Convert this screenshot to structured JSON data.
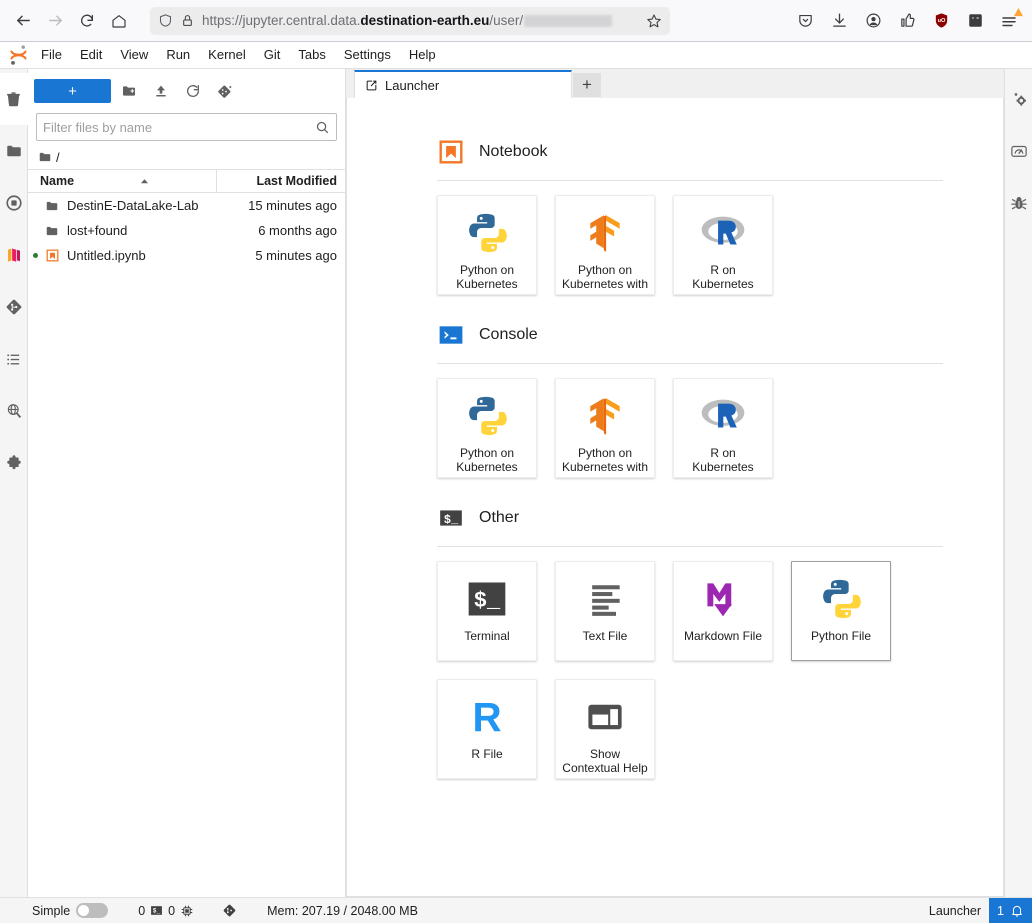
{
  "browser": {
    "back_icon": "arrow-left-icon",
    "forward_icon": "arrow-right-icon",
    "reload_icon": "reload-icon",
    "home_icon": "home-icon",
    "shield_icon": "shield-icon",
    "lock_icon": "lock-icon",
    "url_scheme": "https://jupyter.central.data.",
    "url_host": "destination-earth.eu",
    "url_path": "/user/",
    "url_redacted": true,
    "bookmark_icon": "star-icon",
    "toolbar_icons": [
      {
        "name": "pocket-save-icon"
      },
      {
        "name": "downloads-icon"
      },
      {
        "name": "account-icon"
      },
      {
        "name": "extension-thumb-icon"
      },
      {
        "name": "ublock-origin-icon"
      },
      {
        "name": "container-tabs-icon"
      },
      {
        "name": "app-menu-icon"
      }
    ]
  },
  "menubar": {
    "logo": "jupyter-logo",
    "items": [
      {
        "label": "File"
      },
      {
        "label": "Edit"
      },
      {
        "label": "View"
      },
      {
        "label": "Run"
      },
      {
        "label": "Kernel"
      },
      {
        "label": "Git"
      },
      {
        "label": "Tabs"
      },
      {
        "label": "Settings"
      },
      {
        "label": "Help"
      }
    ]
  },
  "left_sidebar": {
    "items": [
      {
        "name": "file-browser-icon",
        "selected": true
      },
      {
        "name": "folder-icon",
        "selected": false
      },
      {
        "name": "running-terminals-icon",
        "selected": false
      },
      {
        "name": "destine-datalake-icon",
        "selected": false
      },
      {
        "name": "git-icon",
        "selected": false
      },
      {
        "name": "table-of-contents-icon",
        "selected": false
      },
      {
        "name": "search-globe-icon",
        "selected": false
      },
      {
        "name": "extension-manager-icon",
        "selected": false
      }
    ]
  },
  "right_sidebar": {
    "items": [
      {
        "name": "property-inspector-icon"
      },
      {
        "name": "dashboard-gauge-icon"
      },
      {
        "name": "debugger-bug-icon"
      }
    ]
  },
  "filebrowser": {
    "new_launcher_label": "+",
    "toolbar": [
      {
        "name": "new-folder-icon"
      },
      {
        "name": "upload-icon"
      },
      {
        "name": "refresh-icon"
      },
      {
        "name": "git-clone-icon"
      }
    ],
    "filter": {
      "placeholder": "Filter files by name",
      "value": "",
      "icon": "search-icon"
    },
    "breadcrumb": {
      "icon": "folder-icon",
      "path": "/"
    },
    "columns": {
      "name": "Name",
      "last_modified": "Last Modified",
      "sort_icon": "caret-up-icon"
    },
    "rows": [
      {
        "name": "DestinE-DataLake-Lab",
        "modified": "15 minutes ago",
        "icon": "folder-icon",
        "dirty": false
      },
      {
        "name": "lost+found",
        "modified": "6 months ago",
        "icon": "folder-icon",
        "dirty": false
      },
      {
        "name": "Untitled.ipynb",
        "modified": "5 minutes ago",
        "icon": "notebook-icon",
        "dirty": true
      }
    ]
  },
  "dock": {
    "tab": {
      "label": "Launcher",
      "icon": "launcher-icon"
    },
    "add_tab_label": "+"
  },
  "launcher": {
    "sections": [
      {
        "title": "Notebook",
        "icon": "notebook-section-icon",
        "cards": [
          {
            "label": "Python on Kubernetes",
            "icon": "python-icon",
            "hover": false
          },
          {
            "label": "Python on Kubernetes with",
            "icon": "tensorflow-icon",
            "hover": false
          },
          {
            "label": "R on Kubernetes",
            "icon": "r-kernel-icon",
            "hover": false
          }
        ]
      },
      {
        "title": "Console",
        "icon": "console-section-icon",
        "cards": [
          {
            "label": "Python on Kubernetes",
            "icon": "python-icon",
            "hover": false
          },
          {
            "label": "Python on Kubernetes with",
            "icon": "tensorflow-icon",
            "hover": false
          },
          {
            "label": "R on Kubernetes",
            "icon": "r-kernel-icon",
            "hover": false
          }
        ]
      },
      {
        "title": "Other",
        "icon": "terminal-section-icon",
        "cards": [
          {
            "label": "Terminal",
            "icon": "terminal-icon",
            "hover": false
          },
          {
            "label": "Text File",
            "icon": "text-file-icon",
            "hover": false
          },
          {
            "label": "Markdown File",
            "icon": "markdown-icon",
            "hover": false
          },
          {
            "label": "Python File",
            "icon": "python-icon",
            "hover": true
          },
          {
            "label": "R File",
            "icon": "r-file-icon",
            "hover": false
          },
          {
            "label": "Show Contextual Help",
            "icon": "contextual-help-icon",
            "hover": false
          }
        ]
      }
    ]
  },
  "statusbar": {
    "simple_label": "Simple",
    "simple_on": false,
    "kernel_count": "0",
    "terminal_count": "0",
    "terminal_icon": "terminal-icon",
    "kernel_icon": "cpu-icon",
    "git_icon": "git-icon",
    "memory": "Mem: 207.19 / 2048.00 MB",
    "active_tab": "Launcher",
    "notification_count": "1",
    "notification_icon": "bell-icon"
  },
  "colors": {
    "accent": "#1976d2",
    "jupyter_orange": "#f37726",
    "python_blue": "#306998",
    "python_yellow": "#ffd43b",
    "r_blue": "#1c86e8",
    "markdown_purple": "#9c27b0",
    "terminal_dark": "#424242",
    "dirty_green": "#2e7d32"
  }
}
